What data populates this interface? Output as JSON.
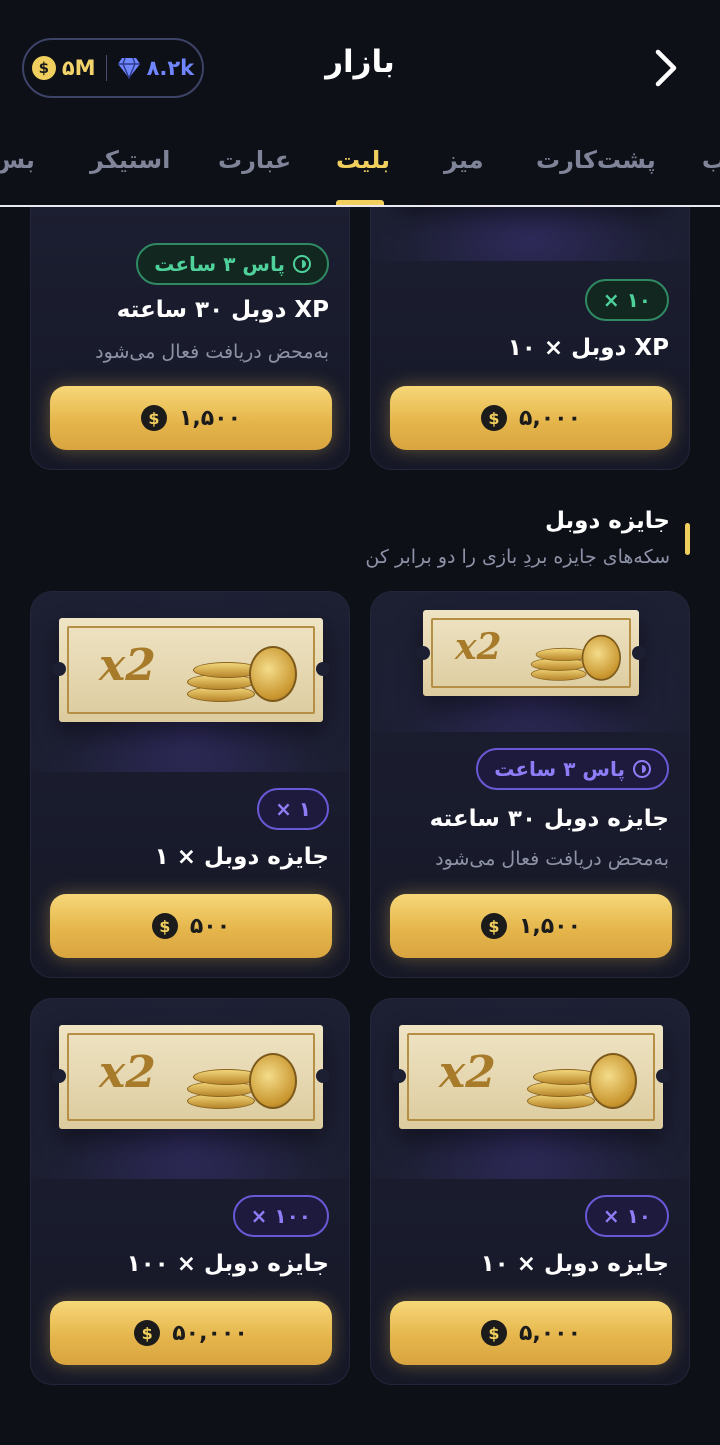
{
  "header": {
    "title": "بازار",
    "balance": {
      "coins": "۵M",
      "gems": "۸.۲k"
    }
  },
  "tabs": [
    {
      "label": "ب",
      "active": false
    },
    {
      "label": "پشت‌کارت",
      "active": false
    },
    {
      "label": "میز",
      "active": false
    },
    {
      "label": "بلیت",
      "active": true
    },
    {
      "label": "عبارت",
      "active": false
    },
    {
      "label": "استیکر",
      "active": false
    },
    {
      "label": "بس",
      "active": false
    }
  ],
  "top_cards": {
    "left": {
      "badge": "پاس ۳ ساعت",
      "title": "XP دوبل ۳۰ ساعته",
      "subtitle": "به‌محض دریافت فعال می‌شود",
      "price": "۱,۵۰۰"
    },
    "right": {
      "badge": "× ۱۰",
      "title": "XP دوبل × ۱۰",
      "price": "۵,۰۰۰"
    }
  },
  "section": {
    "title": "جایزه دوبل",
    "subtitle": "سکه‌های جایزه بردِ بازی را دو برابر کن"
  },
  "prize_cards": [
    {
      "badge": "× ۱",
      "title": "جایزه دوبل × ۱",
      "price": "۵۰۰"
    },
    {
      "badge": "پاس ۳ ساعت",
      "title": "جایزه دوبل ۳۰ ساعته",
      "subtitle": "به‌محض دریافت فعال می‌شود",
      "price": "۱,۵۰۰"
    },
    {
      "badge": "× ۱۰۰",
      "title": "جایزه دوبل × ۱۰۰",
      "price": "۵۰,۰۰۰"
    },
    {
      "badge": "× ۱۰",
      "title": "جایزه دوبل × ۱۰",
      "price": "۵,۰۰۰"
    }
  ],
  "ticket_art": {
    "label": "x2"
  },
  "colors": {
    "background": "#0e1018",
    "gold": "#f1cf5e",
    "green_badge": "#4ed19a",
    "purple_badge": "#8d7df6",
    "muted_text": "#8d92a6"
  }
}
